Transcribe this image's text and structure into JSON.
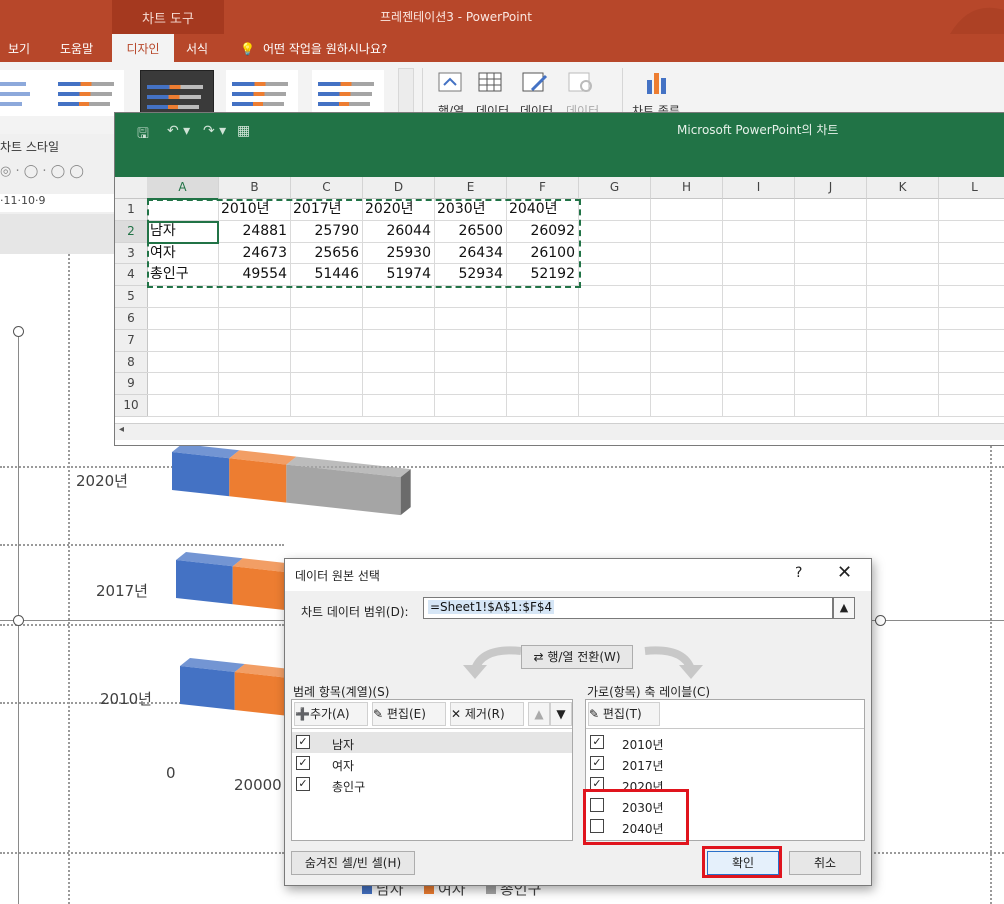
{
  "app": {
    "window_title": "프레젠테이션3 - PowerPoint",
    "context_tab": "차트 도구",
    "tabs": [
      "보기",
      "도움말",
      "디자인",
      "서식"
    ],
    "tell_me": "어떤 작업을 원하시나요?",
    "ribbon_buttons": [
      "행/열",
      "데이터",
      "데이터",
      "데이터",
      "차트 종류"
    ],
    "chart_styles_label": "차트 스타일",
    "ruler_text": "·11·10·9"
  },
  "chart": {
    "y_labels": [
      "2020년",
      "2017년",
      "2010년"
    ],
    "x_labels": [
      "0",
      "20000"
    ],
    "legend": [
      "남자",
      "여자",
      "총인구"
    ],
    "colors": {
      "male": "#4472c4",
      "female": "#ed7d31",
      "total": "#a5a5a5"
    }
  },
  "chart_data": {
    "type": "bar",
    "categories": [
      "2020년",
      "2017년",
      "2010년"
    ],
    "series": [
      {
        "name": "남자",
        "values": [
          26044,
          25790,
          24881
        ]
      },
      {
        "name": "여자",
        "values": [
          25930,
          25656,
          24673
        ]
      },
      {
        "name": "총인구",
        "values": [
          51974,
          51446,
          49554
        ]
      }
    ],
    "legend": "bottom"
  },
  "excel": {
    "title": "Microsoft PowerPoint의 차트",
    "columns": [
      "A",
      "B",
      "C",
      "D",
      "E",
      "F",
      "G",
      "H",
      "I",
      "J",
      "K",
      "L"
    ],
    "rows": [
      "1",
      "2",
      "3",
      "4",
      "5",
      "6",
      "7",
      "8",
      "9",
      "10"
    ],
    "header_row": [
      "",
      "2010년",
      "2017년",
      "2020년",
      "2030년",
      "2040년"
    ],
    "data": [
      [
        "남자",
        "24881",
        "25790",
        "26044",
        "26500",
        "26092"
      ],
      [
        "여자",
        "24673",
        "25656",
        "25930",
        "26434",
        "26100"
      ],
      [
        "총인구",
        "49554",
        "51446",
        "51974",
        "52934",
        "52192"
      ]
    ]
  },
  "dialog": {
    "title": "데이터 원본 선택",
    "help": "?",
    "close": "✕",
    "range_label": "차트 데이터 범위(D):",
    "range_value": "=Sheet1!$A$1:$F$4",
    "switch_button": "행/열 전환(W)",
    "legend_group_label": "범례 항목(계열)(S)",
    "legend_toolbar": {
      "add": "추가(A)",
      "edit": "편집(E)",
      "remove": "제거(R)"
    },
    "legend_items": [
      {
        "label": "남자",
        "checked": true
      },
      {
        "label": "여자",
        "checked": true
      },
      {
        "label": "총인구",
        "checked": true
      }
    ],
    "axis_group_label": "가로(항목) 축 레이블(C)",
    "axis_edit": "편집(T)",
    "axis_items": [
      {
        "label": "2010년",
        "checked": true
      },
      {
        "label": "2017년",
        "checked": true
      },
      {
        "label": "2020년",
        "checked": true
      },
      {
        "label": "2030년",
        "checked": false
      },
      {
        "label": "2040년",
        "checked": false
      }
    ],
    "hidden_cells_button": "숨겨진 셀/빈 셀(H)",
    "ok_button": "확인",
    "cancel_button": "취소"
  }
}
